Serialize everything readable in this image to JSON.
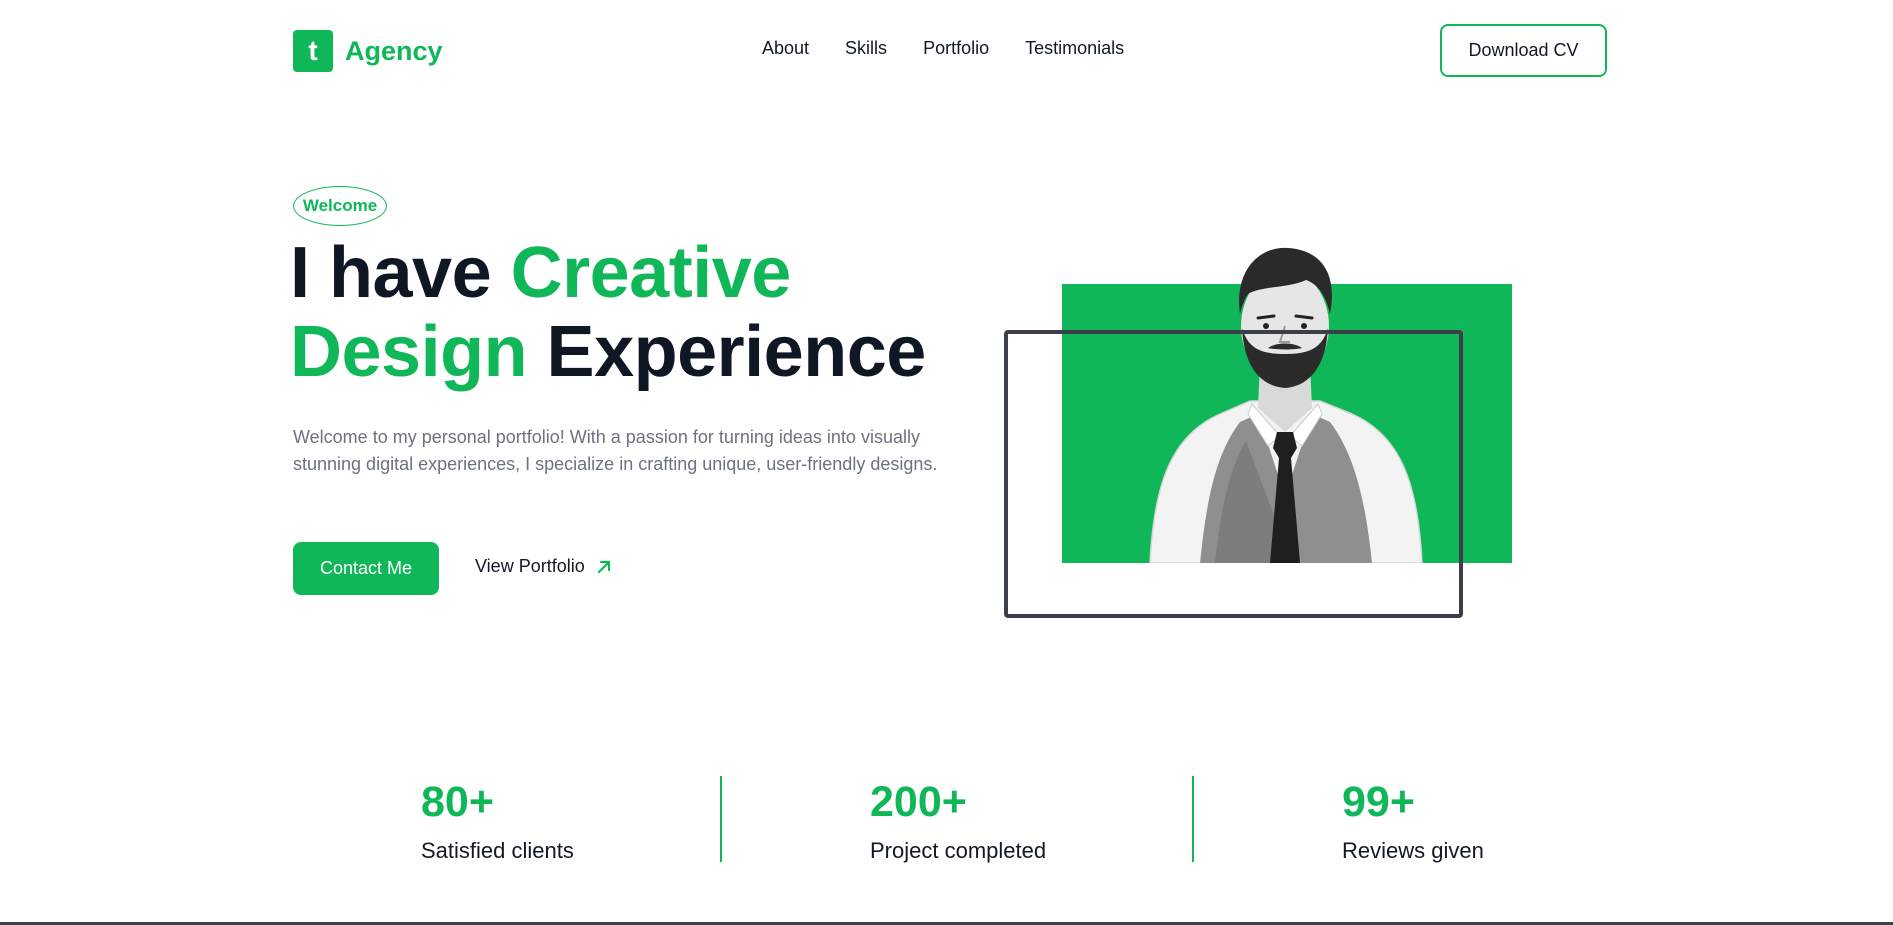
{
  "brand": {
    "logo_letter": "t",
    "name": "Agency",
    "accent_color": "#10b759"
  },
  "nav": {
    "items": [
      {
        "label": "About"
      },
      {
        "label": "Skills"
      },
      {
        "label": "Portfolio"
      },
      {
        "label": "Testimonials"
      }
    ],
    "cta_label": "Download CV"
  },
  "hero": {
    "badge": "Welcome",
    "headline": {
      "part1": "I have ",
      "part2": "Creative",
      "part3": "Design",
      "part4": " Experience"
    },
    "description": "Welcome to my personal portfolio! With a passion for turning ideas into visually stunning digital experiences, I specialize in crafting unique, user-friendly designs.",
    "primary_button": "Contact Me",
    "secondary_link": "View Portfolio",
    "secondary_icon": "arrow-up-right-icon"
  },
  "stats": [
    {
      "value": "80+",
      "label": "Satisfied clients"
    },
    {
      "value": "200+",
      "label": "Project completed"
    },
    {
      "value": "99+",
      "label": "Reviews given"
    }
  ]
}
